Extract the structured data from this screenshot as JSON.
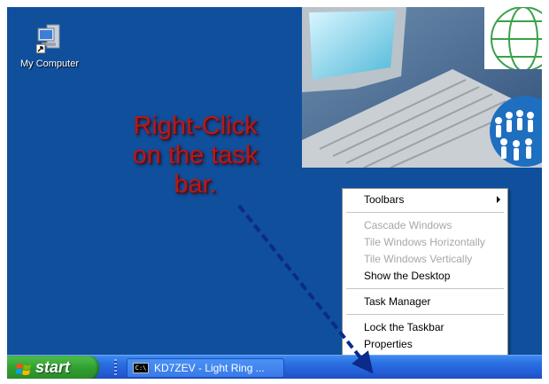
{
  "desktop": {
    "icons": [
      {
        "label": "My Computer",
        "icon": "my-computer-icon"
      }
    ]
  },
  "wallpaper": {
    "background_color": "#0f4f9c",
    "elements": [
      "crt-monitor",
      "keyboard",
      "globe",
      "people-globe"
    ]
  },
  "instruction": {
    "lines": [
      "Right-Click",
      "on the task",
      "bar."
    ],
    "color": "#b11b1b"
  },
  "context_menu": {
    "items": [
      {
        "label": "Toolbars",
        "enabled": true,
        "has_submenu": true
      },
      {
        "label": "Cascade Windows",
        "enabled": false
      },
      {
        "label": "Tile Windows Horizontally",
        "enabled": false
      },
      {
        "label": "Tile Windows Vertically",
        "enabled": false
      },
      {
        "label": "Show the Desktop",
        "enabled": true
      },
      {
        "label": "Task Manager",
        "enabled": true
      },
      {
        "label": "Lock the Taskbar",
        "enabled": true
      },
      {
        "label": "Properties",
        "enabled": true
      }
    ]
  },
  "taskbar": {
    "start_label": "start",
    "task_item": {
      "label": "KD7ZEV - Light Ring ...",
      "icon": "command-prompt-icon",
      "icon_text": "C:\\"
    }
  },
  "annotation_arrow": {
    "color": "#0c2a8a",
    "style": "dashed"
  }
}
